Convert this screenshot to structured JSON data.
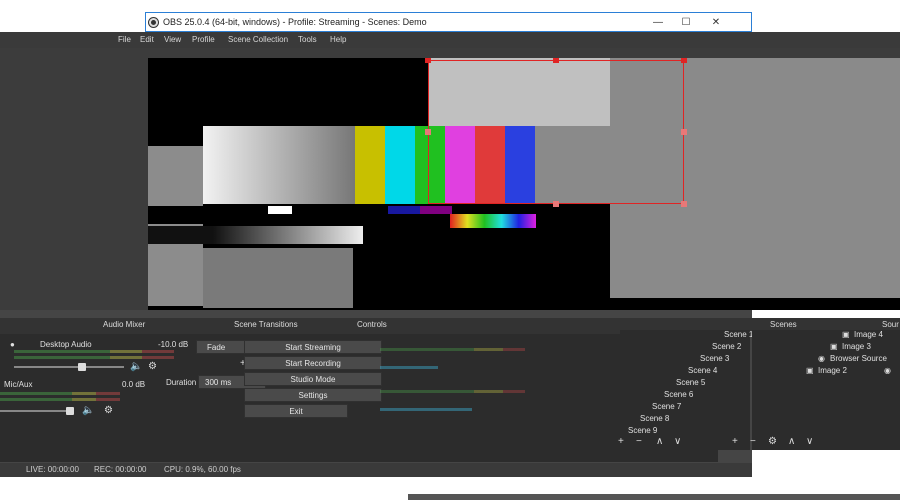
{
  "window": {
    "title": "OBS 25.0.4 (64-bit, windows) - Profile: Streaming - Scenes: Demo",
    "min_glyph": "—",
    "max_glyph": "☐",
    "close_glyph": "✕"
  },
  "menu": [
    "File",
    "Edit",
    "View",
    "Profile",
    "Scene Collection",
    "Tools",
    "Help"
  ],
  "docks": {
    "audio_mixer": "Audio Mixer",
    "scene_transitions": "Scene Transitions",
    "controls": "Controls",
    "scenes": "Scenes",
    "sources": "Sour"
  },
  "mixer": [
    {
      "name": "Desktop Audio",
      "db": "-10.0 dB"
    },
    {
      "name": "Mic/Aux",
      "db": "0.0 dB"
    }
  ],
  "transitions": {
    "selected": "Fade",
    "duration_label": "Duration",
    "duration_value": "300 ms"
  },
  "controls": [
    "Start Streaming",
    "Start Recording",
    "Studio Mode",
    "Settings",
    "Exit"
  ],
  "scenes": [
    "Scene 1",
    "Scene 2",
    "Scene 3",
    "Scene 4",
    "Scene 5",
    "Scene 6",
    "Scene 7",
    "Scene 8",
    "Scene 9"
  ],
  "sources": [
    "Image 4",
    "Image 3",
    "Browser Source",
    "Image 2"
  ],
  "status": {
    "live": "LIVE: 00:00:00",
    "rec": "REC: 00:00:00",
    "cpu": "CPU: 0.9%, 60.00 fps"
  },
  "colors": {
    "accent": "#2b7fd6",
    "selection": "#e02424",
    "meter_green": "#4ca84c",
    "meter_yellow": "#c8c84a",
    "meter_red": "#c84a4a"
  },
  "icons": {
    "add": "+",
    "remove": "−",
    "gear": "⚙",
    "up": "∧",
    "down": "∨",
    "speaker": "🔈",
    "eye": "👁",
    "lock": "🔒"
  }
}
